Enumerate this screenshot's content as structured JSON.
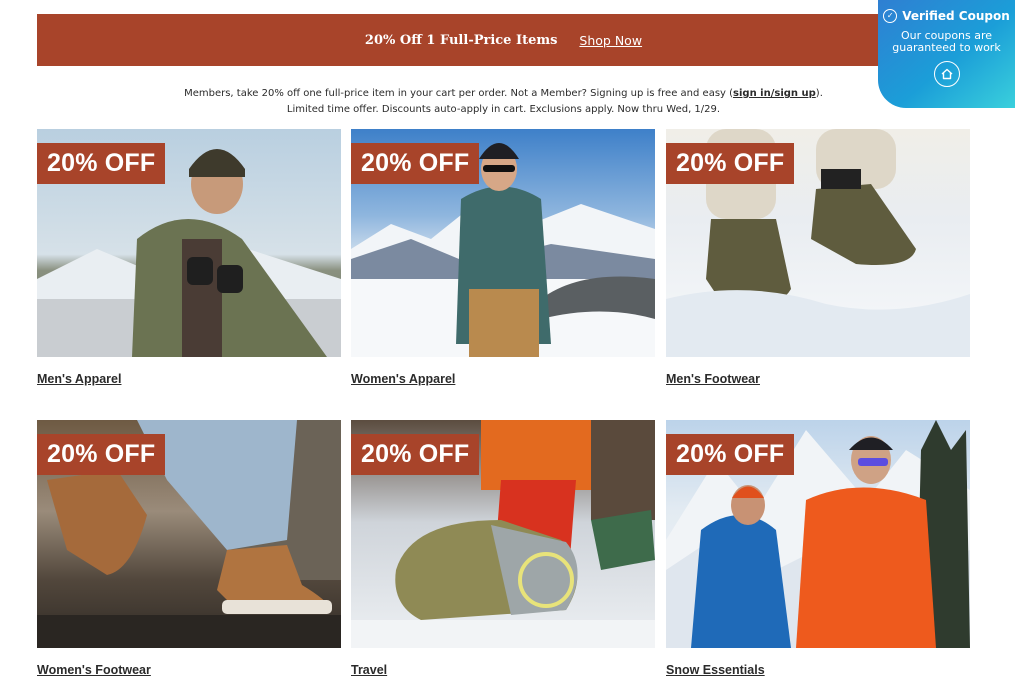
{
  "banner": {
    "title": "20% Off 1 Full-Price Items",
    "link": "Shop Now"
  },
  "coupon": {
    "title": "Verified Coupon",
    "body": "Our coupons are guaranteed to work",
    "check_icon": "check-circle-icon",
    "home_icon": "home-icon"
  },
  "notice": {
    "line1_text": "Members, take 20% off one full-price item in your cart per order. Not a Member? Signing up is free and easy (",
    "line1_link": "sign in/sign up",
    "line1_end": ").",
    "line2": "Limited time offer. Discounts auto-apply in cart. Exclusions apply. Now thru Wed, 1/29."
  },
  "tiles": [
    {
      "badge": "20% OFF",
      "label": "Men's Apparel"
    },
    {
      "badge": "20% OFF",
      "label": "Women's Apparel"
    },
    {
      "badge": "20% OFF",
      "label": "Men's Footwear"
    },
    {
      "badge": "20% OFF",
      "label": "Women's Footwear"
    },
    {
      "badge": "20% OFF",
      "label": "Travel"
    },
    {
      "badge": "20% OFF",
      "label": "Snow Essentials"
    }
  ],
  "colors": {
    "accent": "#a8442a",
    "coupon_gradient_start": "#2f7fd2",
    "coupon_gradient_end": "#3ad0dc"
  }
}
